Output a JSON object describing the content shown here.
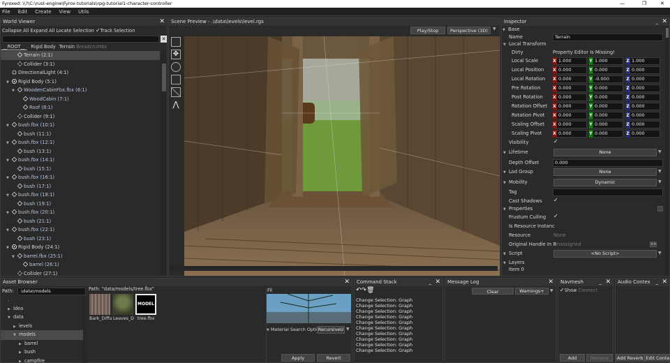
{
  "window": {
    "title": "Fyroxed: \\\\?\\C:\\rust-engine\\Fyrox-tutorials\\rpg-tutorial1-character-controller",
    "min": "—",
    "max": "❐",
    "close": "✕"
  },
  "menu": [
    "File",
    "Edit",
    "Create",
    "View",
    "Utils"
  ],
  "world": {
    "title": "World Viewer",
    "buttons": [
      "Collapse All",
      "Expand All",
      "Locate Selection",
      "Track Selection"
    ],
    "breadcrumbs": [
      "__ROOT__",
      "Rigid Body",
      "Terrain",
      "Breadcrumbs"
    ],
    "items": [
      {
        "label": "Terrain (2:1)",
        "indent": 3,
        "icon": "cube",
        "tri": "",
        "sel": true
      },
      {
        "label": "Collider (3:1)",
        "indent": 3,
        "icon": "coll",
        "tri": ""
      },
      {
        "label": "DirectionalLight (4:1)",
        "indent": 2,
        "icon": "light",
        "tri": ""
      },
      {
        "label": "Rigid Body (5:1)",
        "indent": 2,
        "icon": "rb",
        "tri": "▼"
      },
      {
        "label": "WoodenCabinFbx.fbx (6:1)",
        "indent": 3,
        "icon": "cube",
        "tri": "▼",
        "dim": true
      },
      {
        "label": "WoodCabin (7:1)",
        "indent": 4,
        "icon": "cube",
        "tri": "",
        "dim": true
      },
      {
        "label": "Roof (8:1)",
        "indent": 4,
        "icon": "cube",
        "tri": "",
        "dim": true
      },
      {
        "label": "Collider (9:1)",
        "indent": 3,
        "icon": "coll",
        "tri": ""
      },
      {
        "label": "bush.fbx (10:1)",
        "indent": 2,
        "icon": "cube",
        "tri": "▼",
        "dim": true
      },
      {
        "label": "bush (11:1)",
        "indent": 3,
        "icon": "cube",
        "tri": "",
        "dim": true
      },
      {
        "label": "bush.fbx (12:1)",
        "indent": 2,
        "icon": "cube",
        "tri": "▼",
        "dim": true
      },
      {
        "label": "bush (13:1)",
        "indent": 3,
        "icon": "cube",
        "tri": "",
        "dim": true
      },
      {
        "label": "bush.fbx (14:1)",
        "indent": 2,
        "icon": "cube",
        "tri": "▼",
        "dim": true
      },
      {
        "label": "bush (15:1)",
        "indent": 3,
        "icon": "cube",
        "tri": "",
        "dim": true
      },
      {
        "label": "bush.fbx (16:1)",
        "indent": 2,
        "icon": "cube",
        "tri": "▼",
        "dim": true
      },
      {
        "label": "bush (17:1)",
        "indent": 3,
        "icon": "cube",
        "tri": "",
        "dim": true
      },
      {
        "label": "bush.fbx (18:1)",
        "indent": 2,
        "icon": "cube",
        "tri": "▼",
        "dim": true
      },
      {
        "label": "bush (19:1)",
        "indent": 3,
        "icon": "cube",
        "tri": "",
        "dim": true
      },
      {
        "label": "bush.fbx (20:1)",
        "indent": 2,
        "icon": "cube",
        "tri": "▼",
        "dim": true
      },
      {
        "label": "bush (21:1)",
        "indent": 3,
        "icon": "cube",
        "tri": "",
        "dim": true
      },
      {
        "label": "bush.fbx (22:1)",
        "indent": 2,
        "icon": "cube",
        "tri": "▼",
        "dim": true
      },
      {
        "label": "bush (23:1)",
        "indent": 3,
        "icon": "cube",
        "tri": "",
        "dim": true
      },
      {
        "label": "Rigid Body (24:1)",
        "indent": 2,
        "icon": "rb",
        "tri": "▼"
      },
      {
        "label": "barrel.fbx (25:1)",
        "indent": 3,
        "icon": "cube",
        "tri": "▼",
        "dim": true
      },
      {
        "label": "barrel (26:1)",
        "indent": 4,
        "icon": "cube",
        "tri": "",
        "dim": true
      },
      {
        "label": "Collider (27:1)",
        "indent": 3,
        "icon": "coll",
        "tri": ""
      }
    ]
  },
  "scene": {
    "title": "Scene Preview - .\\data\\levels\\level.rgs",
    "play": "Play/Stop",
    "camera": "Perspective (3D)"
  },
  "inspector": {
    "title": "Inspector",
    "base": "Base",
    "name_label": "Name",
    "name_value": "Terrain",
    "local_transform": "Local Transform",
    "dirty": "Dirty",
    "dirty_value": "Property Editor Is Missing!",
    "vec_rows": [
      {
        "label": "Local Scale",
        "x": "1.000",
        "y": "1.000",
        "z": "1.000"
      },
      {
        "label": "Local Position",
        "x": "0.000",
        "y": "0.000",
        "z": "0.000"
      },
      {
        "label": "Local Rotation",
        "x": "0.000",
        "y": "-0.000",
        "z": "0.000"
      },
      {
        "label": "Pre Rotation",
        "x": "0.000",
        "y": "0.000",
        "z": "0.000"
      },
      {
        "label": "Post Rotation",
        "x": "0.000",
        "y": "0.000",
        "z": "0.000"
      },
      {
        "label": "Rotation Offset",
        "x": "0.000",
        "y": "0.000",
        "z": "0.000"
      },
      {
        "label": "Rotation Pivot",
        "x": "0.000",
        "y": "0.000",
        "z": "0.000"
      },
      {
        "label": "Scaling Offset",
        "x": "0.000",
        "y": "0.000",
        "z": "0.000"
      },
      {
        "label": "Scaling Pivot",
        "x": "0.000",
        "y": "0.000",
        "z": "0.000"
      }
    ],
    "axis_x": "X",
    "axis_y": "Y",
    "axis_z": "Z",
    "visibility": "Visibility",
    "lifetime": "Lifetime",
    "lifetime_value": "None",
    "depth_offset": "Depth Offset",
    "depth_value": "0.000",
    "lod": "Lod Group",
    "lod_value": "None",
    "mobility": "Mobility",
    "mobility_value": "Dynamic",
    "tag": "Tag",
    "cast_shadows": "Cast Shadows",
    "properties": "Properties",
    "frustum": "Frustum Culling",
    "is_resource": "Is Resource Instanc",
    "resource": "Resource",
    "resource_value": "None",
    "original_handle": "Original Handle In R",
    "original_value": "Unassigned",
    "script": "Script",
    "script_value": "<No Script>",
    "layers": "Layers",
    "item0": "Item 0",
    "more": ">>"
  },
  "asset": {
    "title": "Asset Browser",
    "path_label": "Path:",
    "path_value": ".\\data\\models",
    "tree": [
      {
        "label": ".",
        "indent": 0
      },
      {
        "label": "idea",
        "indent": 1,
        "tri": "▶"
      },
      {
        "label": "data",
        "indent": 1,
        "tri": "▼"
      },
      {
        "label": "levels",
        "indent": 2,
        "tri": "▶"
      },
      {
        "label": "models",
        "indent": 2,
        "tri": "▼",
        "sel": true
      },
      {
        "label": "barrel",
        "indent": 3,
        "tri": "▶"
      },
      {
        "label": "bush",
        "indent": 3,
        "tri": "▶"
      },
      {
        "label": "campfire",
        "indent": 3,
        "tri": "▶"
      }
    ],
    "files_path": "Path: \"data/models/tree.fbx\"",
    "files": [
      "Bark_Diffu",
      "Leaves_D",
      "tree.fbx"
    ],
    "model_badge": "MODEL",
    "preview_label": "Fil",
    "material_label": "Material Search Optic",
    "material_value": "RecursiveU",
    "apply": "Apply",
    "revert": "Revert"
  },
  "command": {
    "title": "Command Stack",
    "entries": [
      "Change Selection: Graph",
      "Change Selection: Graph",
      "Change Selection: Graph",
      "Change Selection: Graph",
      "Change Selection: Graph",
      "Change Selection: Graph",
      "Change Selection: Graph",
      "Change Selection: Graph",
      "Change Selection: Graph",
      "Change Selection: Graph"
    ]
  },
  "log": {
    "title": "Message Log",
    "clear": "Clear",
    "filter": "Warnings+"
  },
  "navmesh": {
    "title": "Navmesh",
    "show": "Show",
    "connect": "Connect",
    "add": "Add",
    "remove": "Remove"
  },
  "audio": {
    "title": "Audio Contex",
    "buttons": [
      "Add Reverb",
      "Edit Context"
    ]
  }
}
